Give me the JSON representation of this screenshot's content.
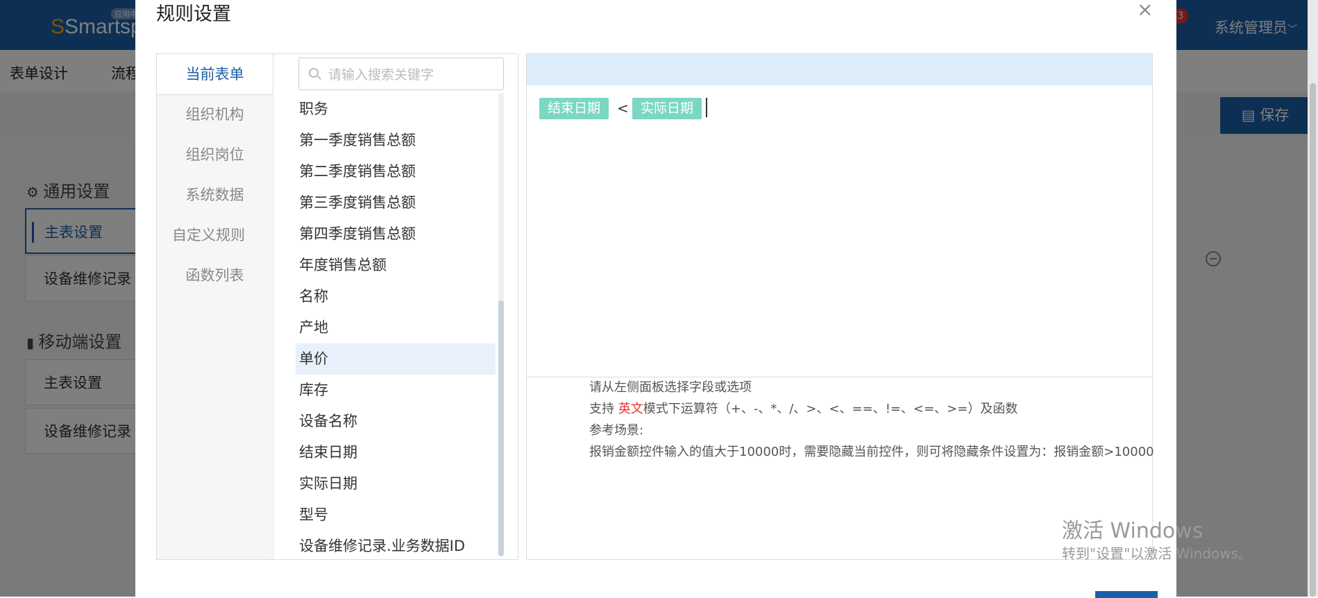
{
  "app": {
    "logo_text": "Smartspac",
    "logo_badge": "应用中",
    "notif_count": "3",
    "user_name": "系统管理员",
    "user_chevron": "﹀",
    "subnav": [
      "表单设计",
      "流程"
    ],
    "save_label": "保存",
    "save_icon": "document-icon"
  },
  "left_settings": {
    "general_title": "通用设置",
    "general_items": [
      "主表设置",
      "设备维修记录"
    ],
    "mobile_title": "移动端设置",
    "mobile_items": [
      "主表设置",
      "设备维修记录"
    ]
  },
  "modal": {
    "title": "规则设置",
    "close_glyph": "×",
    "tabs": [
      "当前表单",
      "组织机构",
      "组织岗位",
      "系统数据",
      "自定义规则",
      "函数列表"
    ],
    "active_tab": "当前表单",
    "search_placeholder": "请输入搜索关键字",
    "fields": [
      "职务",
      "第一季度销售总额",
      "第二季度销售总额",
      "第三季度销售总额",
      "第四季度销售总额",
      "年度销售总额",
      "名称",
      "产地",
      "单价",
      "库存",
      "设备名称",
      "结束日期",
      "实际日期",
      "型号",
      "设备维修记录.业务数据ID"
    ],
    "selected_field": "单价",
    "expression": {
      "token1": "结束日期",
      "operator": "<",
      "token2": "实际日期"
    },
    "help": {
      "line1": "请从左侧面板选择字段或选项",
      "line2_prefix": "支持 ",
      "line2_highlight": "英文",
      "line2_suffix": "模式下运算符（+、-、*、/、>、<、==、!=、<=、>=）及函数",
      "line3": "参考场景:",
      "line4": "报销金额控件输入的值大于10000时，需要隐藏当前控件，则可将隐藏条件设置为：报销金额>10000"
    }
  },
  "watermark": {
    "line1": "激活 Windows",
    "line2": "转到\"设置\"以激活 Windows。"
  },
  "colors": {
    "brand": "#1a5fa8",
    "token": "#7bd7c4",
    "highlight": "#e33333"
  }
}
